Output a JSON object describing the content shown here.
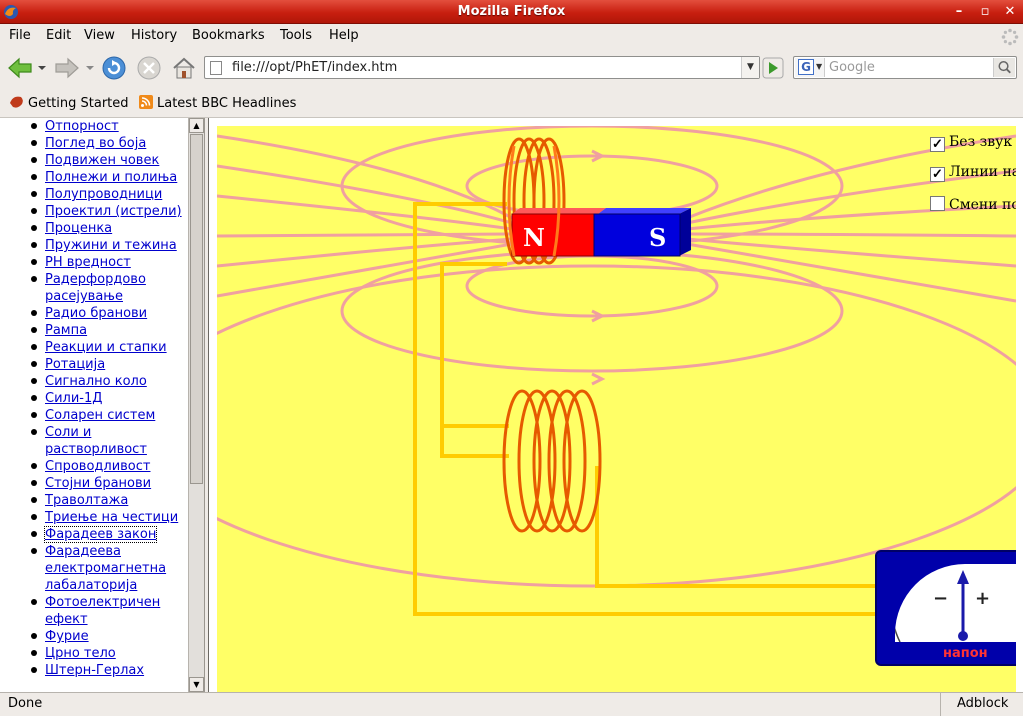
{
  "window": {
    "title": "Mozilla Firefox"
  },
  "menu": [
    "File",
    "Edit",
    "View",
    "History",
    "Bookmarks",
    "Tools",
    "Help"
  ],
  "nav": {
    "url": "file:///opt/PhET/index.htm",
    "search_placeholder": "Google"
  },
  "bookmarks": [
    "Getting Started",
    "Latest BBC Headlines"
  ],
  "sidebar": {
    "items": [
      "Отпорност",
      "Поглед во боја",
      "Подвижен човек",
      "Полнежи и полиња",
      "Полупроводници",
      "Проектил (истрели)",
      "Проценка",
      "Пружини и тежина",
      "PH вредност",
      "Радерфордово расејување",
      "Радио бранови",
      "Рампа",
      "Реакции и стапки",
      "Ротација",
      "Сигнално коло",
      "Сили-1Д",
      "Соларен систем",
      "Соли и растворливост",
      "Спроводливост",
      "Стојни бранови",
      "Траволтажа",
      "Триење на честици",
      "Фарадеев закон",
      "Фарадеева електромагнетна лабалаторија",
      "Фотоелектричен ефект",
      "Фурие",
      "Црно тело",
      "Штерн-Герлах"
    ],
    "selected_index": 22
  },
  "sim": {
    "magnet_n": "N",
    "magnet_s": "S",
    "checkboxes": [
      {
        "label": "Без звук",
        "checked": true
      },
      {
        "label": "Линии на",
        "checked": true
      },
      {
        "label": "Смени по",
        "checked": false
      }
    ],
    "meter_minus": "−",
    "meter_plus": "+",
    "meter_label": "напон",
    "colors": {
      "background": "#ffff66",
      "field_lines": "#f0a0a0",
      "wire": "#ffcc00",
      "coil": "#e65a00",
      "north": "#ff0000",
      "south": "#0000dd"
    }
  },
  "status": {
    "text": "Done",
    "addon": "Adblock"
  }
}
